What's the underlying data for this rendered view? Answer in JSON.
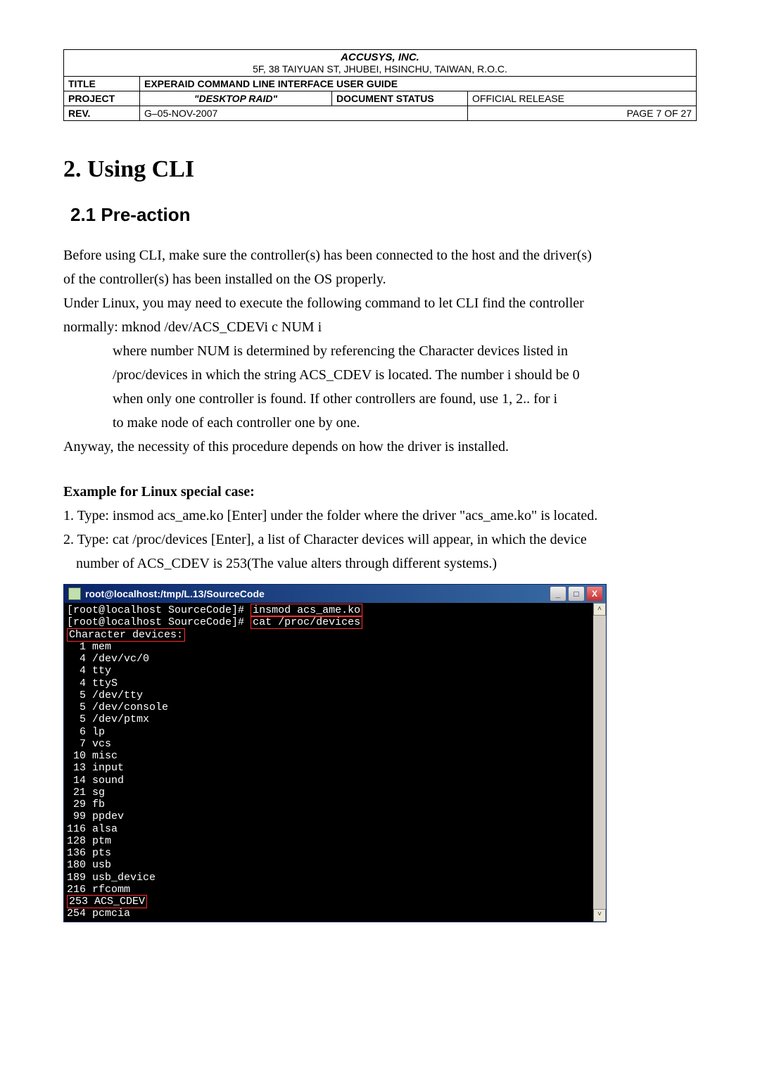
{
  "header": {
    "company": "ACCUSYS, INC.",
    "address": "5F, 38 TAIYUAN ST, JHUBEI, HSINCHU, TAIWAN, R.O.C.",
    "title_label": "TITLE",
    "title_value": "EXPERAID COMMAND LINE INTERFACE USER GUIDE",
    "project_label": "PROJECT",
    "project_value": "\"DESKTOP RAID\"",
    "docstatus_label": "DOCUMENT   STATUS",
    "docstatus_value": "OFFICIAL RELEASE",
    "rev_label": "REV.",
    "rev_value": "G–05-NOV-2007",
    "page_value": "PAGE 7 OF 27"
  },
  "section_heading": "2. Using CLI",
  "subsection_heading": "2.1 Pre-action",
  "para1_line1": "Before using CLI, make sure the controller(s) has been connected to the host and the driver(s)",
  "para1_line2": "of the controller(s) has been installed on the OS properly.",
  "para2_line1": "Under Linux, you may need to execute the following command to let CLI find the controller",
  "para2_line2": "normally: mknod /dev/ACS_CDEVi c NUM i",
  "indent_line1": "where number NUM is determined by referencing the Character devices listed in",
  "indent_line2": "/proc/devices in which the string ACS_CDEV is located. The number i should be 0",
  "indent_line3": "when only one controller is found. If other controllers are found, use 1, 2.. for i",
  "indent_line4": "to make node of each controller one by one.",
  "para3": "Anyway, the necessity of this procedure depends on how the driver is installed.",
  "example_heading": "Example for Linux special case:",
  "example_step1": "1. Type: insmod acs_ame.ko [Enter] under the folder where the driver \"acs_ame.ko\" is located.",
  "example_step2a": "2. Type: cat /proc/devices [Enter], a list of Character devices will appear, in which the device",
  "example_step2b": "number of ACS_CDEV is 253(The value alters through different systems.)",
  "terminal": {
    "title": "root@localhost:/tmp/L.13/SourceCode",
    "prompt1_pre": "[root@localhost SourceCode]#",
    "prompt1_cmd": "insmod acs_ame.ko",
    "prompt2_pre": "[root@localhost SourceCode]#",
    "prompt2_cmd": "cat /proc/devices",
    "chardev_label": "Character devices:",
    "lines": [
      "  1 mem",
      "  4 /dev/vc/0",
      "  4 tty",
      "  4 ttyS",
      "  5 /dev/tty",
      "  5 /dev/console",
      "  5 /dev/ptmx",
      "  6 lp",
      "  7 vcs",
      " 10 misc",
      " 13 input",
      " 14 sound",
      " 21 sg",
      " 29 fb",
      " 99 ppdev",
      "116 alsa",
      "128 ptm",
      "136 pts",
      "180 usb",
      "189 usb_device",
      "216 rfcomm"
    ],
    "highlight_line": "253 ACS_CDEV",
    "last_line": "254 pcmcia"
  },
  "win_btns": {
    "min": "_",
    "max": "□",
    "close": "X"
  },
  "scroll": {
    "up": "˄",
    "down": "˅"
  }
}
